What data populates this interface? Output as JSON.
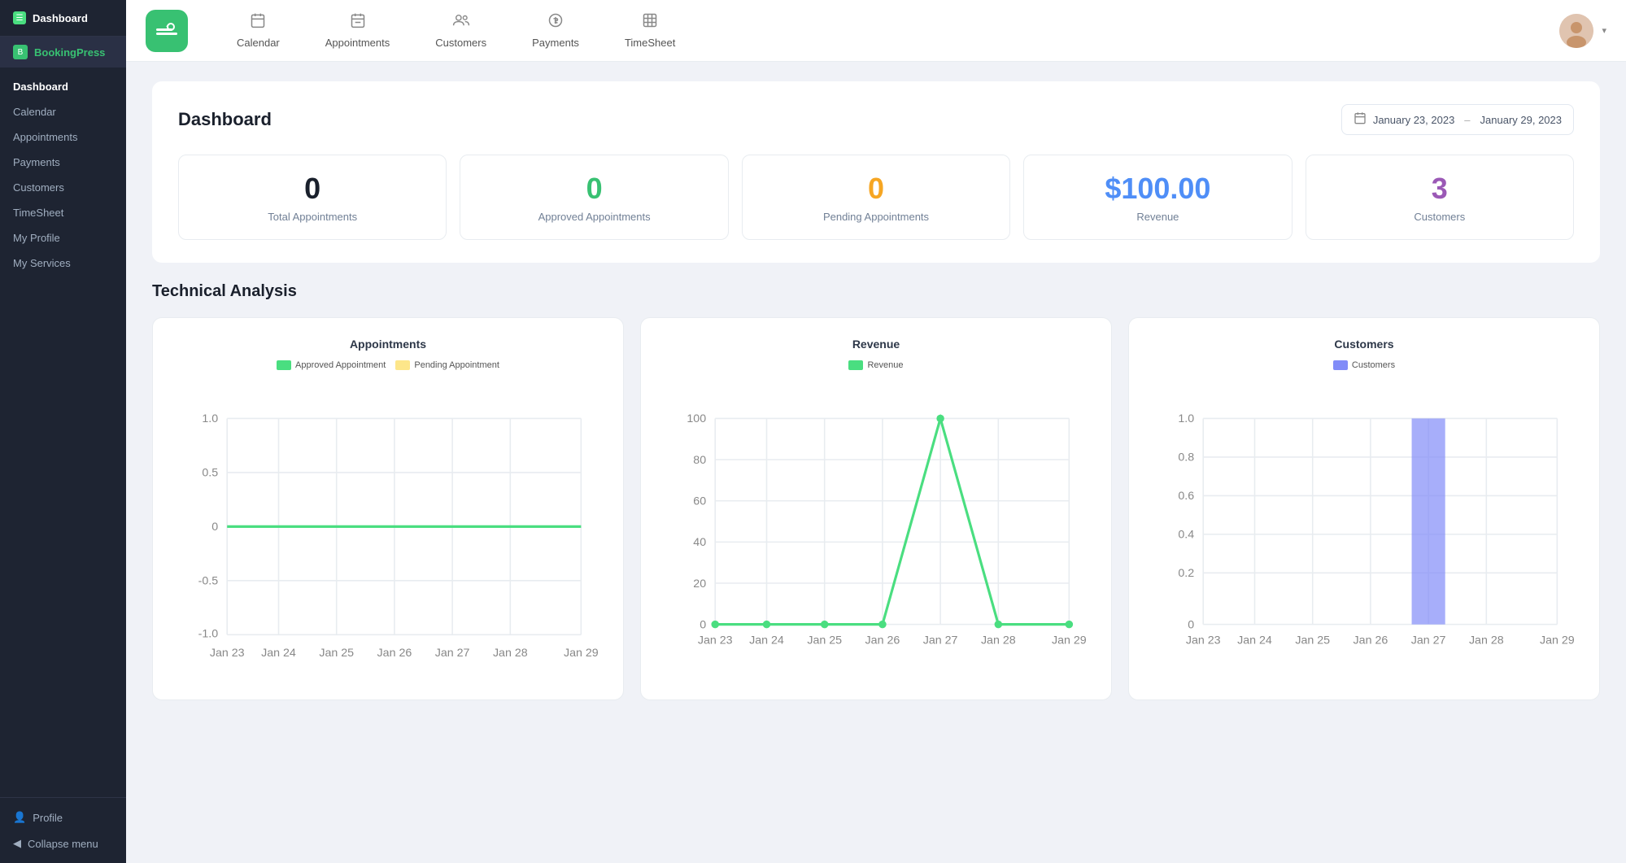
{
  "sidebar": {
    "header": {
      "icon": "☰",
      "label": "Dashboard"
    },
    "brand": {
      "icon": "B",
      "label": "BookingPress"
    },
    "nav": [
      {
        "id": "dashboard",
        "label": "Dashboard",
        "active": true
      },
      {
        "id": "calendar",
        "label": "Calendar",
        "active": false
      },
      {
        "id": "appointments",
        "label": "Appointments",
        "active": false
      },
      {
        "id": "payments",
        "label": "Payments",
        "active": false
      },
      {
        "id": "customers",
        "label": "Customers",
        "active": false
      },
      {
        "id": "timesheet",
        "label": "TimeSheet",
        "active": false
      },
      {
        "id": "my-profile",
        "label": "My Profile",
        "active": false
      },
      {
        "id": "my-services",
        "label": "My Services",
        "active": false
      }
    ],
    "footer": [
      {
        "id": "profile",
        "label": "Profile",
        "icon": "👤"
      },
      {
        "id": "collapse",
        "label": "Collapse menu",
        "icon": "◀"
      }
    ]
  },
  "topnav": {
    "logo_icon": "✂",
    "items": [
      {
        "id": "calendar",
        "label": "Calendar",
        "icon": "📅"
      },
      {
        "id": "appointments",
        "label": "Appointments",
        "icon": "📋"
      },
      {
        "id": "customers",
        "label": "Customers",
        "icon": "👥"
      },
      {
        "id": "payments",
        "label": "Payments",
        "icon": "💲"
      },
      {
        "id": "timesheet",
        "label": "TimeSheet",
        "icon": "🗓"
      }
    ],
    "avatar_icon": "👩"
  },
  "dashboard": {
    "title": "Dashboard",
    "date_range": {
      "from": "January 23, 2023",
      "separator": "–",
      "to": "January 29, 2023"
    },
    "stats": [
      {
        "id": "total-appointments",
        "value": "0",
        "label": "Total Appointments",
        "color": "#1a202c"
      },
      {
        "id": "approved-appointments",
        "value": "0",
        "label": "Approved Appointments",
        "color": "#38c172"
      },
      {
        "id": "pending-appointments",
        "value": "0",
        "label": "Pending Appointments",
        "color": "#f6a623"
      },
      {
        "id": "revenue",
        "value": "$100.00",
        "label": "Revenue",
        "color": "#4f8ef7"
      },
      {
        "id": "customers",
        "value": "3",
        "label": "Customers",
        "color": "#9b59b6"
      }
    ]
  },
  "technical_analysis": {
    "title": "Technical Analysis",
    "charts": [
      {
        "id": "appointments-chart",
        "title": "Appointments",
        "legend": [
          {
            "label": "Approved Appointment",
            "color": "#4ade80"
          },
          {
            "label": "Pending Appointment",
            "color": "#fde68a"
          }
        ],
        "xLabels": [
          "Jan 23",
          "Jan 24",
          "Jan 25",
          "Jan 26",
          "Jan 27",
          "Jan 28",
          "Jan 29"
        ],
        "yLabels": [
          "1.0",
          "0.5",
          "0",
          "-0.5",
          "-1.0"
        ],
        "type": "line"
      },
      {
        "id": "revenue-chart",
        "title": "Revenue",
        "legend": [
          {
            "label": "Revenue",
            "color": "#4ade80"
          }
        ],
        "xLabels": [
          "Jan 23",
          "Jan 24",
          "Jan 25",
          "Jan 26",
          "Jan 27",
          "Jan 28",
          "Jan 29"
        ],
        "yLabels": [
          "100",
          "80",
          "60",
          "40",
          "20",
          "0"
        ],
        "type": "line-spike"
      },
      {
        "id": "customers-chart",
        "title": "Customers",
        "legend": [
          {
            "label": "Customers",
            "color": "#818cf8"
          }
        ],
        "xLabels": [
          "Jan 23",
          "Jan 24",
          "Jan 25",
          "Jan 26",
          "Jan 27",
          "Jan 28",
          "Jan 29"
        ],
        "yLabels": [
          "1.0",
          "0.8",
          "0.6",
          "0.4",
          "0.2",
          "0"
        ],
        "type": "bar"
      }
    ]
  }
}
